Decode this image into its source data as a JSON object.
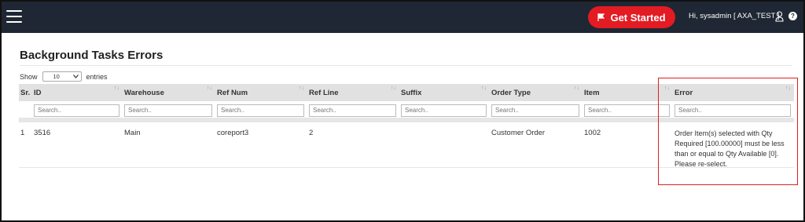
{
  "topbar": {
    "get_started_label": "Get Started",
    "user_greeting": "Hi, sysadmin [ AXA_TEST ]",
    "help_glyph": "?"
  },
  "page": {
    "title": "Background Tasks Errors",
    "show_label": "Show",
    "entries_value": "10",
    "entries_label": "entries"
  },
  "table": {
    "headers": {
      "sr": "Sr.",
      "id": "ID",
      "warehouse": "Warehouse",
      "ref_num": "Ref Num",
      "ref_line": "Ref Line",
      "suffix": "Suffix",
      "order_type": "Order Type",
      "item": "Item",
      "error": "Error"
    },
    "search_placeholder": "Search..",
    "rows": [
      {
        "sr": "1",
        "id": "3516",
        "warehouse": "Main",
        "ref_num": "coreport3",
        "ref_line": "2",
        "suffix": "",
        "order_type": "Customer Order",
        "item": "1002",
        "error": "Order Item(s) selected with Qty Required [100.00000] must be less than or equal to Qty Available [0]. Please re-select."
      }
    ]
  },
  "icons": {
    "menu": "hamburger-icon",
    "flag": "flag-icon",
    "user": "user-icon",
    "help": "help-icon",
    "sort": "sort-icon",
    "dropdown": "chevron-down-icon"
  },
  "colors": {
    "topbar_bg": "#1e2733",
    "accent": "#e31b23",
    "highlight_box": "#e01e1e"
  }
}
